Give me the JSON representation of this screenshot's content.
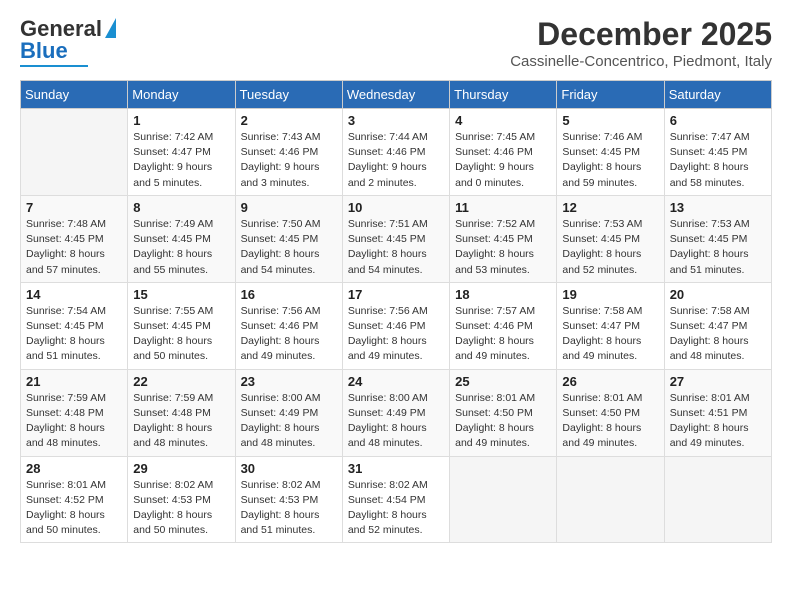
{
  "logo": {
    "general": "General",
    "blue": "Blue"
  },
  "header": {
    "month": "December 2025",
    "location": "Cassinelle-Concentrico, Piedmont, Italy"
  },
  "weekdays": [
    "Sunday",
    "Monday",
    "Tuesday",
    "Wednesday",
    "Thursday",
    "Friday",
    "Saturday"
  ],
  "weeks": [
    [
      {
        "day": "",
        "sunrise": "",
        "sunset": "",
        "daylight": ""
      },
      {
        "day": "1",
        "sunrise": "Sunrise: 7:42 AM",
        "sunset": "Sunset: 4:47 PM",
        "daylight": "Daylight: 9 hours and 5 minutes."
      },
      {
        "day": "2",
        "sunrise": "Sunrise: 7:43 AM",
        "sunset": "Sunset: 4:46 PM",
        "daylight": "Daylight: 9 hours and 3 minutes."
      },
      {
        "day": "3",
        "sunrise": "Sunrise: 7:44 AM",
        "sunset": "Sunset: 4:46 PM",
        "daylight": "Daylight: 9 hours and 2 minutes."
      },
      {
        "day": "4",
        "sunrise": "Sunrise: 7:45 AM",
        "sunset": "Sunset: 4:46 PM",
        "daylight": "Daylight: 9 hours and 0 minutes."
      },
      {
        "day": "5",
        "sunrise": "Sunrise: 7:46 AM",
        "sunset": "Sunset: 4:45 PM",
        "daylight": "Daylight: 8 hours and 59 minutes."
      },
      {
        "day": "6",
        "sunrise": "Sunrise: 7:47 AM",
        "sunset": "Sunset: 4:45 PM",
        "daylight": "Daylight: 8 hours and 58 minutes."
      }
    ],
    [
      {
        "day": "7",
        "sunrise": "Sunrise: 7:48 AM",
        "sunset": "Sunset: 4:45 PM",
        "daylight": "Daylight: 8 hours and 57 minutes."
      },
      {
        "day": "8",
        "sunrise": "Sunrise: 7:49 AM",
        "sunset": "Sunset: 4:45 PM",
        "daylight": "Daylight: 8 hours and 55 minutes."
      },
      {
        "day": "9",
        "sunrise": "Sunrise: 7:50 AM",
        "sunset": "Sunset: 4:45 PM",
        "daylight": "Daylight: 8 hours and 54 minutes."
      },
      {
        "day": "10",
        "sunrise": "Sunrise: 7:51 AM",
        "sunset": "Sunset: 4:45 PM",
        "daylight": "Daylight: 8 hours and 54 minutes."
      },
      {
        "day": "11",
        "sunrise": "Sunrise: 7:52 AM",
        "sunset": "Sunset: 4:45 PM",
        "daylight": "Daylight: 8 hours and 53 minutes."
      },
      {
        "day": "12",
        "sunrise": "Sunrise: 7:53 AM",
        "sunset": "Sunset: 4:45 PM",
        "daylight": "Daylight: 8 hours and 52 minutes."
      },
      {
        "day": "13",
        "sunrise": "Sunrise: 7:53 AM",
        "sunset": "Sunset: 4:45 PM",
        "daylight": "Daylight: 8 hours and 51 minutes."
      }
    ],
    [
      {
        "day": "14",
        "sunrise": "Sunrise: 7:54 AM",
        "sunset": "Sunset: 4:45 PM",
        "daylight": "Daylight: 8 hours and 51 minutes."
      },
      {
        "day": "15",
        "sunrise": "Sunrise: 7:55 AM",
        "sunset": "Sunset: 4:45 PM",
        "daylight": "Daylight: 8 hours and 50 minutes."
      },
      {
        "day": "16",
        "sunrise": "Sunrise: 7:56 AM",
        "sunset": "Sunset: 4:46 PM",
        "daylight": "Daylight: 8 hours and 49 minutes."
      },
      {
        "day": "17",
        "sunrise": "Sunrise: 7:56 AM",
        "sunset": "Sunset: 4:46 PM",
        "daylight": "Daylight: 8 hours and 49 minutes."
      },
      {
        "day": "18",
        "sunrise": "Sunrise: 7:57 AM",
        "sunset": "Sunset: 4:46 PM",
        "daylight": "Daylight: 8 hours and 49 minutes."
      },
      {
        "day": "19",
        "sunrise": "Sunrise: 7:58 AM",
        "sunset": "Sunset: 4:47 PM",
        "daylight": "Daylight: 8 hours and 49 minutes."
      },
      {
        "day": "20",
        "sunrise": "Sunrise: 7:58 AM",
        "sunset": "Sunset: 4:47 PM",
        "daylight": "Daylight: 8 hours and 48 minutes."
      }
    ],
    [
      {
        "day": "21",
        "sunrise": "Sunrise: 7:59 AM",
        "sunset": "Sunset: 4:48 PM",
        "daylight": "Daylight: 8 hours and 48 minutes."
      },
      {
        "day": "22",
        "sunrise": "Sunrise: 7:59 AM",
        "sunset": "Sunset: 4:48 PM",
        "daylight": "Daylight: 8 hours and 48 minutes."
      },
      {
        "day": "23",
        "sunrise": "Sunrise: 8:00 AM",
        "sunset": "Sunset: 4:49 PM",
        "daylight": "Daylight: 8 hours and 48 minutes."
      },
      {
        "day": "24",
        "sunrise": "Sunrise: 8:00 AM",
        "sunset": "Sunset: 4:49 PM",
        "daylight": "Daylight: 8 hours and 48 minutes."
      },
      {
        "day": "25",
        "sunrise": "Sunrise: 8:01 AM",
        "sunset": "Sunset: 4:50 PM",
        "daylight": "Daylight: 8 hours and 49 minutes."
      },
      {
        "day": "26",
        "sunrise": "Sunrise: 8:01 AM",
        "sunset": "Sunset: 4:50 PM",
        "daylight": "Daylight: 8 hours and 49 minutes."
      },
      {
        "day": "27",
        "sunrise": "Sunrise: 8:01 AM",
        "sunset": "Sunset: 4:51 PM",
        "daylight": "Daylight: 8 hours and 49 minutes."
      }
    ],
    [
      {
        "day": "28",
        "sunrise": "Sunrise: 8:01 AM",
        "sunset": "Sunset: 4:52 PM",
        "daylight": "Daylight: 8 hours and 50 minutes."
      },
      {
        "day": "29",
        "sunrise": "Sunrise: 8:02 AM",
        "sunset": "Sunset: 4:53 PM",
        "daylight": "Daylight: 8 hours and 50 minutes."
      },
      {
        "day": "30",
        "sunrise": "Sunrise: 8:02 AM",
        "sunset": "Sunset: 4:53 PM",
        "daylight": "Daylight: 8 hours and 51 minutes."
      },
      {
        "day": "31",
        "sunrise": "Sunrise: 8:02 AM",
        "sunset": "Sunset: 4:54 PM",
        "daylight": "Daylight: 8 hours and 52 minutes."
      },
      {
        "day": "",
        "sunrise": "",
        "sunset": "",
        "daylight": ""
      },
      {
        "day": "",
        "sunrise": "",
        "sunset": "",
        "daylight": ""
      },
      {
        "day": "",
        "sunrise": "",
        "sunset": "",
        "daylight": ""
      }
    ]
  ]
}
